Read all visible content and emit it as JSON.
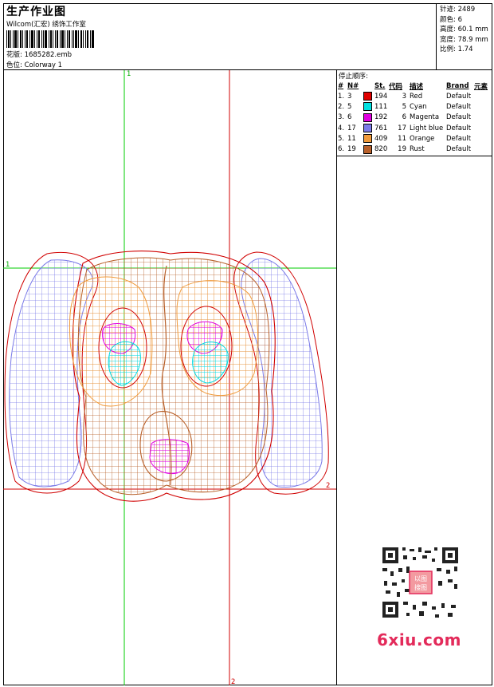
{
  "header": {
    "title": "生产作业图",
    "studio": "Wilcom(汇宏) 绣饰工作室",
    "design_label": "花版: 1685282.emb",
    "colorway_label": "色位: Colorway 1"
  },
  "stats": {
    "stitches": "针迹: 2489",
    "colors": "颜色: 6",
    "height": "高度: 60.1 mm",
    "width": "宽度: 78.9 mm",
    "scale": "比例: 1.74"
  },
  "stop_sequence": {
    "title": "停止顺序:",
    "headers": [
      "#",
      "N#",
      "St.",
      "代码",
      "描述",
      "Brand",
      "元素"
    ],
    "rows": [
      {
        "idx": "1.",
        "n": "3",
        "color": "#e00000",
        "st": "194",
        "code": "3",
        "desc": "Red",
        "brand": "Default"
      },
      {
        "idx": "2.",
        "n": "5",
        "color": "#00e0e0",
        "st": "111",
        "code": "5",
        "desc": "Cyan",
        "brand": "Default"
      },
      {
        "idx": "3.",
        "n": "6",
        "color": "#e000e0",
        "st": "192",
        "code": "6",
        "desc": "Magenta",
        "brand": "Default"
      },
      {
        "idx": "4.",
        "n": "17",
        "color": "#7b7be8",
        "st": "761",
        "code": "17",
        "desc": "Light blue",
        "brand": "Default"
      },
      {
        "idx": "5.",
        "n": "11",
        "color": "#f09a3a",
        "st": "409",
        "code": "11",
        "desc": "Orange",
        "brand": "Default"
      },
      {
        "idx": "6.",
        "n": "19",
        "color": "#b8602a",
        "st": "820",
        "code": "19",
        "desc": "Rust",
        "brand": "Default"
      }
    ]
  },
  "axes": {
    "green_top": "1",
    "green_left": "1",
    "red_right": "2",
    "red_bottom": "2"
  },
  "watermark": {
    "site": "6xiu.com",
    "badge": "以图\n搜图"
  }
}
